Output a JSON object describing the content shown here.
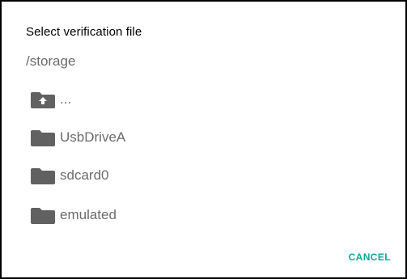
{
  "dialog": {
    "title": "Select verification file",
    "path": "/storage",
    "items": [
      {
        "label": "...",
        "icon": "folder-up-icon"
      },
      {
        "label": "UsbDriveA",
        "icon": "folder-icon"
      },
      {
        "label": "sdcard0",
        "icon": "folder-icon"
      },
      {
        "label": "emulated",
        "icon": "folder-icon"
      }
    ],
    "cancel_label": "CANCEL"
  },
  "colors": {
    "accent": "#0aa89b",
    "folder": "#616161",
    "text_secondary": "#6b6b6b"
  }
}
